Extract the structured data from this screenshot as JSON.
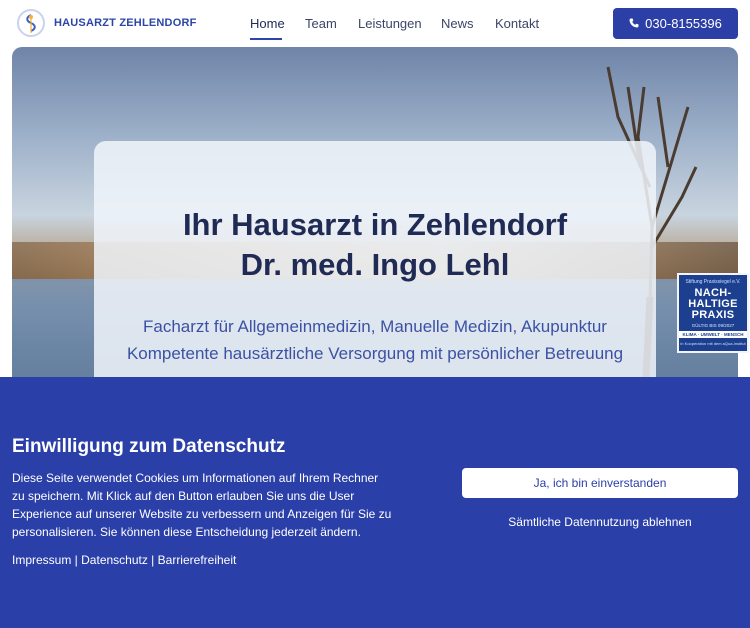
{
  "header": {
    "brand": "HAUSARZT ZEHLENDORF",
    "nav": [
      {
        "label": "Home",
        "active": true
      },
      {
        "label": "Team"
      },
      {
        "label": "Leistungen"
      },
      {
        "label": "News"
      },
      {
        "label": "Kontakt"
      }
    ],
    "phone": "030-8155396"
  },
  "hero": {
    "title_line1": "Ihr Hausarzt in Zehlendorf",
    "title_line2": "Dr. med. Ingo Lehl",
    "subtitle_line1": "Facharzt für Allgemeinmedizin, Manuelle Medizin, Akupunktur",
    "subtitle_line2": "Kompetente hausärztliche Versorgung mit persönlicher Betreuung"
  },
  "badge": {
    "top": "Stiftung Praxissiegel e.V.",
    "line1": "NACH-",
    "line2": "HALTIGE",
    "line3": "PRAXIS",
    "valid": "GÜLTIG BIS 09/2027",
    "bar": "KLIMA · UMWELT · MENSCH",
    "foot": "in Kooperation mit dem aQua-Institut"
  },
  "consent": {
    "title": "Einwilligung zum Datenschutz",
    "text": "Diese Seite verwendet Cookies um Informationen auf Ihrem Rechner zu speichern. Mit Klick auf den Button erlauben Sie uns die User Experience auf unserer Website zu verbessern und Anzeigen für Sie zu personalisieren. Sie können diese Entscheidung jederzeit ändern.",
    "links": [
      "Impressum",
      "Datenschutz",
      "Barrierefreiheit"
    ],
    "separator": " | ",
    "accept": "Ja, ich bin einverstanden",
    "decline": "Sämtliche Datennutzung ablehnen"
  },
  "colors": {
    "primary": "#2b3fa8",
    "title": "#1f2a55",
    "subtitle": "#3b52a4"
  },
  "icons": {
    "logo": "caduceus-logo-icon",
    "phone": "phone-icon"
  }
}
